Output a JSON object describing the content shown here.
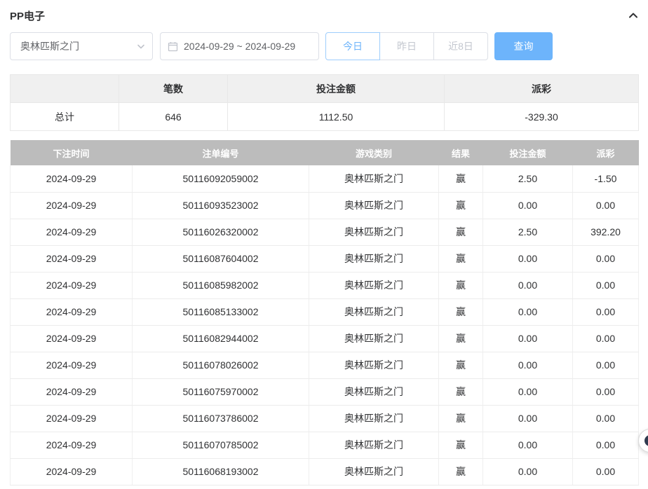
{
  "panel": {
    "title": "PP电子"
  },
  "filters": {
    "game_select": {
      "value": "奥林匹斯之门"
    },
    "date_range": "2024-09-29 ~ 2024-09-29",
    "quick_buttons": [
      {
        "label": "今日",
        "active": true
      },
      {
        "label": "昨日",
        "active": false
      },
      {
        "label": "近8日",
        "active": false
      }
    ],
    "search_label": "查询"
  },
  "summary": {
    "headers": [
      "",
      "笔数",
      "投注金额",
      "派彩"
    ],
    "row_label": "总计",
    "count": "646",
    "bet_amount": "1112.50",
    "payout": "-329.30"
  },
  "table": {
    "headers": [
      "下注时间",
      "注单编号",
      "游戏类别",
      "结果",
      "投注金额",
      "派彩"
    ],
    "rows": [
      {
        "date": "2024-09-29",
        "order_no": "50116092059002",
        "game": "奥林匹斯之门",
        "result": "赢",
        "bet": "2.50",
        "payout": "-1.50"
      },
      {
        "date": "2024-09-29",
        "order_no": "50116093523002",
        "game": "奥林匹斯之门",
        "result": "赢",
        "bet": "0.00",
        "payout": "0.00"
      },
      {
        "date": "2024-09-29",
        "order_no": "50116026320002",
        "game": "奥林匹斯之门",
        "result": "赢",
        "bet": "2.50",
        "payout": "392.20"
      },
      {
        "date": "2024-09-29",
        "order_no": "50116087604002",
        "game": "奥林匹斯之门",
        "result": "赢",
        "bet": "0.00",
        "payout": "0.00"
      },
      {
        "date": "2024-09-29",
        "order_no": "50116085982002",
        "game": "奥林匹斯之门",
        "result": "赢",
        "bet": "0.00",
        "payout": "0.00"
      },
      {
        "date": "2024-09-29",
        "order_no": "50116085133002",
        "game": "奥林匹斯之门",
        "result": "赢",
        "bet": "0.00",
        "payout": "0.00"
      },
      {
        "date": "2024-09-29",
        "order_no": "50116082944002",
        "game": "奥林匹斯之门",
        "result": "赢",
        "bet": "0.00",
        "payout": "0.00"
      },
      {
        "date": "2024-09-29",
        "order_no": "50116078026002",
        "game": "奥林匹斯之门",
        "result": "赢",
        "bet": "0.00",
        "payout": "0.00"
      },
      {
        "date": "2024-09-29",
        "order_no": "50116075970002",
        "game": "奥林匹斯之门",
        "result": "赢",
        "bet": "0.00",
        "payout": "0.00"
      },
      {
        "date": "2024-09-29",
        "order_no": "50116073786002",
        "game": "奥林匹斯之门",
        "result": "赢",
        "bet": "0.00",
        "payout": "0.00"
      },
      {
        "date": "2024-09-29",
        "order_no": "50116070785002",
        "game": "奥林匹斯之门",
        "result": "赢",
        "bet": "0.00",
        "payout": "0.00"
      },
      {
        "date": "2024-09-29",
        "order_no": "50116068193002",
        "game": "奥林匹斯之门",
        "result": "赢",
        "bet": "0.00",
        "payout": "0.00"
      }
    ]
  },
  "colors": {
    "accent_blue": "#6db4fb",
    "negative_red": "#f56c6c",
    "table_header_gray": "#bcbcbc"
  }
}
